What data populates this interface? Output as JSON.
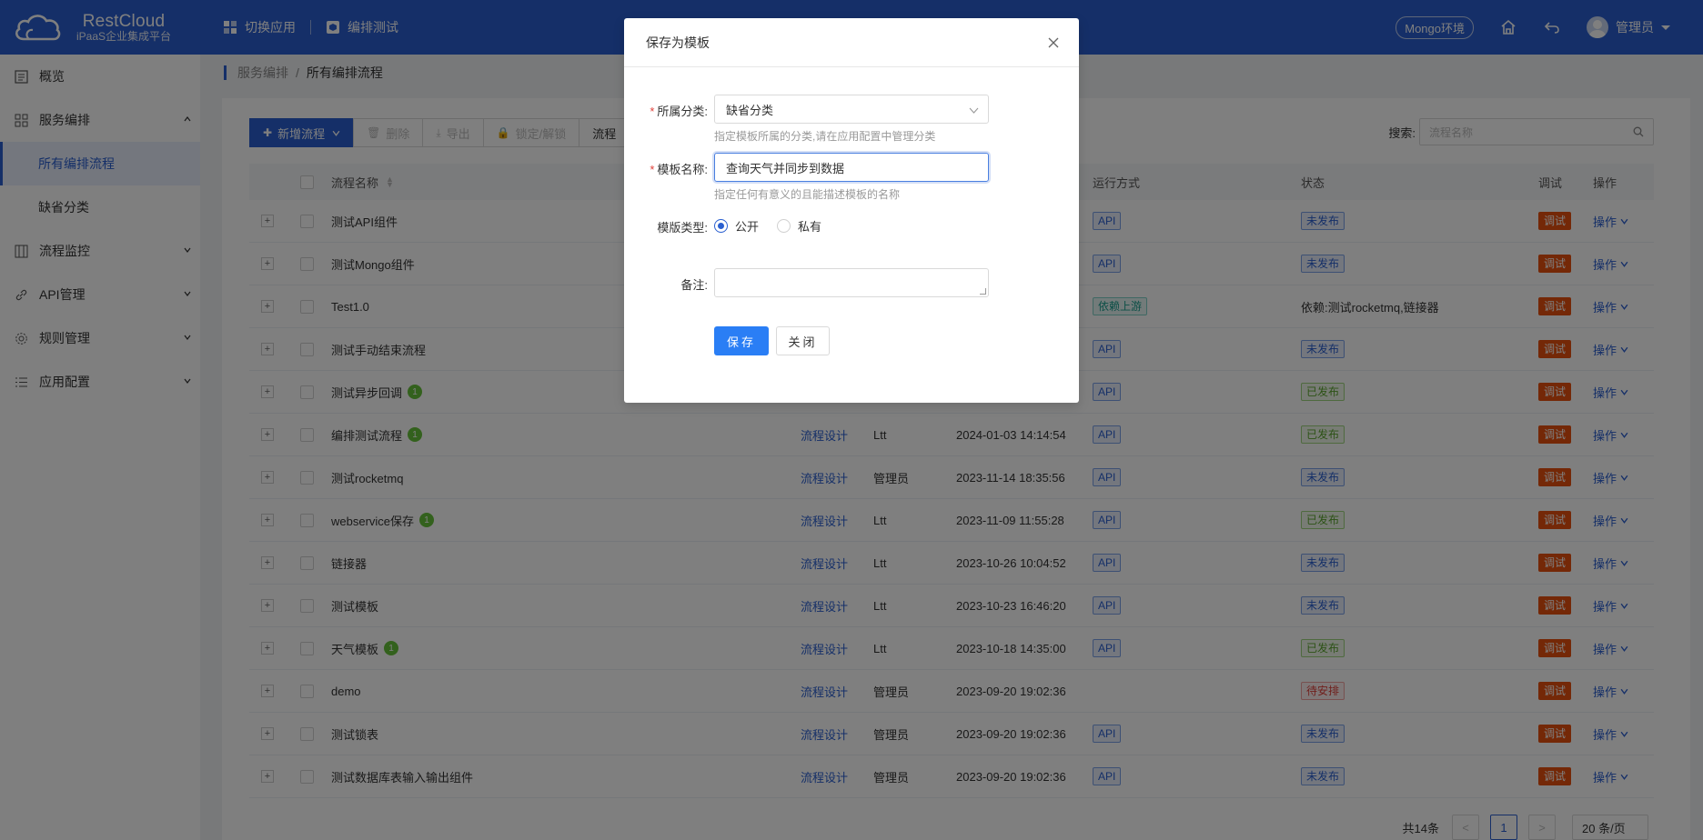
{
  "header": {
    "logo_name": "RestCloud",
    "logo_sub": "iPaaS企业集成平台",
    "switch_app": "切换应用",
    "current_app": "编排测试",
    "env": "Mongo环境",
    "user": "管理员"
  },
  "sidebar": {
    "items": [
      {
        "label": "概览",
        "icon": "overview-icon"
      },
      {
        "label": "服务编排",
        "icon": "grid-icon",
        "expanded": true
      },
      {
        "label": "所有编排流程",
        "sub": true,
        "active": true
      },
      {
        "label": "缺省分类",
        "sub": true
      },
      {
        "label": "流程监控",
        "icon": "monitor-icon"
      },
      {
        "label": "API管理",
        "icon": "link-icon"
      },
      {
        "label": "规则管理",
        "icon": "gear-icon"
      },
      {
        "label": "应用配置",
        "icon": "list-icon"
      }
    ]
  },
  "breadcrumb": {
    "parent": "服务编排",
    "sep": "/",
    "current": "所有编排流程"
  },
  "toolbar": {
    "add": "新增流程",
    "delete": "删除",
    "export": "导出",
    "lock": "锁定/解锁",
    "flow": "流程"
  },
  "search": {
    "label": "搜索:",
    "placeholder": "流程名称"
  },
  "table": {
    "headers": {
      "name": "流程名称",
      "run": "运行方式",
      "status": "状态",
      "debug": "调试",
      "op": "操作"
    },
    "rows": [
      {
        "name": "测试API组件",
        "badge": "",
        "design": "",
        "user": "",
        "time": "",
        "run": "API",
        "run_type": "api",
        "status": "未发布",
        "status_type": "unpub"
      },
      {
        "name": "测试Mongo组件",
        "badge": "",
        "design": "",
        "user": "",
        "time": "",
        "run": "API",
        "run_type": "api",
        "status": "未发布",
        "status_type": "unpub"
      },
      {
        "name": "Test1.0",
        "badge": "",
        "design": "",
        "user": "",
        "time": "",
        "run": "依赖上游",
        "run_type": "dep",
        "status": "依赖:测试rocketmq,链接器",
        "status_type": "text"
      },
      {
        "name": "测试手动结束流程",
        "badge": "",
        "design": "",
        "user": "",
        "time": "",
        "run": "API",
        "run_type": "api",
        "status": "未发布",
        "status_type": "unpub"
      },
      {
        "name": "测试异步回调",
        "badge": "1",
        "design": "",
        "user": "",
        "time": "",
        "run": "API",
        "run_type": "api",
        "status": "已发布",
        "status_type": "pub"
      },
      {
        "name": "编排测试流程",
        "badge": "1",
        "design": "流程设计",
        "user": "Ltt",
        "time": "2024-01-03 14:14:54",
        "run": "API",
        "run_type": "api",
        "status": "已发布",
        "status_type": "pub"
      },
      {
        "name": "测试rocketmq",
        "badge": "",
        "design": "流程设计",
        "user": "管理员",
        "time": "2023-11-14 18:35:56",
        "run": "API",
        "run_type": "api",
        "status": "未发布",
        "status_type": "unpub"
      },
      {
        "name": "webservice保存",
        "badge": "1",
        "design": "流程设计",
        "user": "Ltt",
        "time": "2023-11-09 11:55:28",
        "run": "API",
        "run_type": "api",
        "status": "已发布",
        "status_type": "pub"
      },
      {
        "name": "链接器",
        "badge": "",
        "design": "流程设计",
        "user": "Ltt",
        "time": "2023-10-26 10:04:52",
        "run": "API",
        "run_type": "api",
        "status": "未发布",
        "status_type": "unpub"
      },
      {
        "name": "测试模板",
        "badge": "",
        "design": "流程设计",
        "user": "Ltt",
        "time": "2023-10-23 16:46:20",
        "run": "API",
        "run_type": "api",
        "status": "未发布",
        "status_type": "unpub"
      },
      {
        "name": "天气模板",
        "badge": "1",
        "design": "流程设计",
        "user": "Ltt",
        "time": "2023-10-18 14:35:00",
        "run": "API",
        "run_type": "api",
        "status": "已发布",
        "status_type": "pub"
      },
      {
        "name": "demo",
        "badge": "",
        "design": "流程设计",
        "user": "管理员",
        "time": "2023-09-20 19:02:36",
        "run": "",
        "run_type": "none",
        "status": "待安排",
        "status_type": "pend"
      },
      {
        "name": "测试锁表",
        "badge": "",
        "design": "流程设计",
        "user": "管理员",
        "time": "2023-09-20 19:02:36",
        "run": "API",
        "run_type": "api",
        "status": "未发布",
        "status_type": "unpub"
      },
      {
        "name": "测试数据库表输入输出组件",
        "badge": "",
        "design": "流程设计",
        "user": "管理员",
        "time": "2023-09-20 19:02:36",
        "run": "API",
        "run_type": "api",
        "status": "未发布",
        "status_type": "unpub"
      }
    ],
    "debug_label": "调试",
    "op_label": "操作"
  },
  "pager": {
    "total": "共14条",
    "prev": "<",
    "page": "1",
    "next": ">",
    "size": "20 条/页"
  },
  "modal": {
    "title": "保存为模板",
    "category_label": "所属分类:",
    "category_value": "缺省分类",
    "category_hint": "指定模板所属的分类,请在应用配置中管理分类",
    "name_label": "模板名称:",
    "name_value": "查询天气并同步到数据",
    "name_hint": "指定任何有意义的且能描述模板的名称",
    "type_label": "模版类型:",
    "type_public": "公开",
    "type_private": "私有",
    "type_selected": "公开",
    "remark_label": "备注:",
    "remark_value": "",
    "save": "保存",
    "close": "关闭"
  },
  "colors": {
    "brand": "#2a5fd0",
    "debug": "#e8500e",
    "success": "#67c23a"
  }
}
